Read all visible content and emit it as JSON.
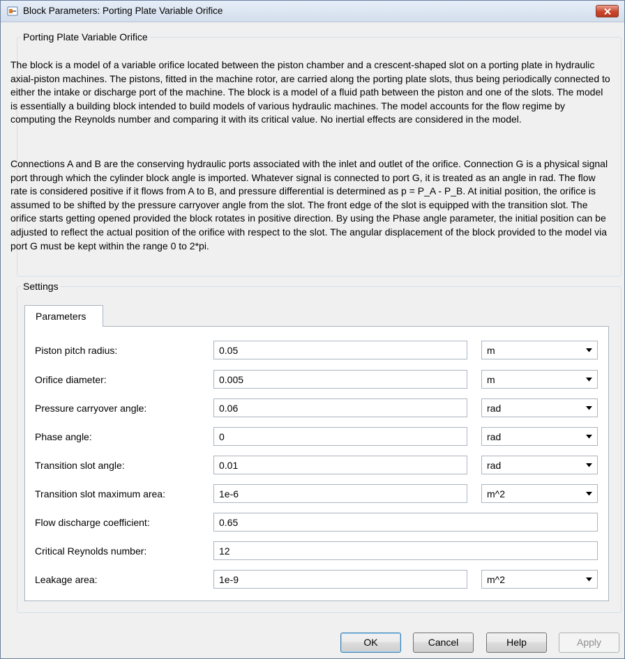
{
  "window": {
    "title": "Block Parameters: Porting Plate Variable Orifice"
  },
  "block": {
    "group_title": "Porting Plate Variable Orifice",
    "description_p1": "The block is a model of a variable orifice located between the piston chamber and a crescent-shaped slot on a porting plate in hydraulic axial-piston machines. The pistons, fitted in the machine rotor, are carried along the porting plate slots, thus being periodically connected to either the intake or discharge port of the machine. The block is a model of a fluid path between the piston and one of the slots. The model is essentially a building block intended to build models of various hydraulic machines. The model accounts for the flow regime by computing the Reynolds number and comparing it with its critical value. No inertial effects are considered in the model.",
    "description_p2": "Connections A and B are the conserving hydraulic ports associated with the inlet and outlet of the orifice. Connection G is a physical signal port through which the cylinder block angle is imported. Whatever signal is connected to port G, it is treated as an angle in rad. The flow rate is considered positive if it flows from A to B, and pressure differential is determined as p = P_A - P_B. At initial position, the orifice is assumed to be shifted by the pressure carryover angle from the slot. The front edge of the slot is equipped with the transition slot. The orifice starts getting opened provided the block rotates in positive direction. By using the Phase angle parameter, the initial position can be adjusted to reflect the actual position of the orifice with respect to the slot. The angular displacement of the block provided to the model via port G must be kept within the range 0 to 2*pi."
  },
  "settings": {
    "group_title": "Settings",
    "tab_label": "Parameters",
    "params": [
      {
        "label": "Piston pitch radius:",
        "value": "0.05",
        "unit": "m"
      },
      {
        "label": "Orifice diameter:",
        "value": "0.005",
        "unit": "m"
      },
      {
        "label": "Pressure carryover angle:",
        "value": "0.06",
        "unit": "rad"
      },
      {
        "label": "Phase angle:",
        "value": "0",
        "unit": "rad"
      },
      {
        "label": "Transition slot angle:",
        "value": "0.01",
        "unit": "rad"
      },
      {
        "label": "Transition slot maximum area:",
        "value": "1e-6",
        "unit": "m^2"
      },
      {
        "label": "Flow discharge coefficient:",
        "value": "0.65"
      },
      {
        "label": "Critical Reynolds number:",
        "value": "12"
      },
      {
        "label": "Leakage area:",
        "value": "1e-9",
        "unit": "m^2"
      }
    ]
  },
  "buttons": {
    "ok": "OK",
    "cancel": "Cancel",
    "help": "Help",
    "apply": "Apply"
  },
  "icons": {
    "app": "simulink-block-icon",
    "close": "close-icon",
    "dropdown": "chevron-down-icon"
  },
  "colors": {
    "close_button": "#c9452c",
    "group_border": "#d5dfe5",
    "panel_background": "#ffffff",
    "window_background": "#f0f0f0"
  }
}
